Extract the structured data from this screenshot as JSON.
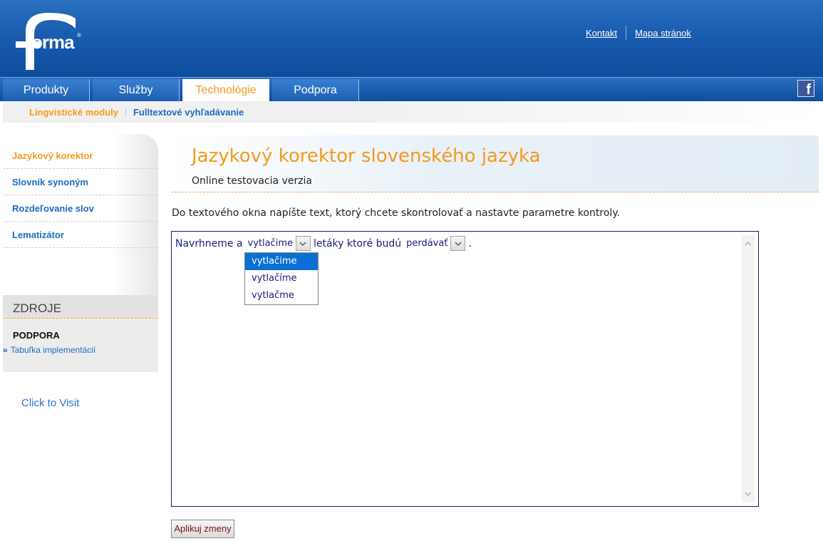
{
  "header": {
    "logo_text": "orma",
    "logo_reg": "®",
    "links": [
      "Kontakt",
      "Mapa stránok"
    ]
  },
  "nav": {
    "tabs": [
      "Produkty",
      "Služby",
      "Technológie",
      "Podpora"
    ],
    "active_tab": "Technológie",
    "facebook_icon": "facebook-icon"
  },
  "subnav": {
    "items": [
      "Lingvistické moduly",
      "Fulltextové vyhľadávanie"
    ]
  },
  "sidebar": {
    "items": [
      "Jazykový korektor",
      "Slovník synoným",
      "Rozdeľovanie slov",
      "Lematizátor"
    ],
    "resources_heading": "ZDROJE",
    "support_heading": "PODPORA",
    "support_link": "Tabuľka implementácií",
    "support_link_chevron": "»",
    "click_visit": "Click to Visit"
  },
  "main": {
    "title": "Jazykový korektor slovenského jazyka",
    "subtitle": "Online testovacia verzia",
    "instructions": "Do textového okna napíšte text, ktorý chcete skontrolovať a nastavte parametre kontroly.",
    "editor": {
      "word1": "Navrhneme a",
      "select1": "vytlačime",
      "word2": "letáky ktoré budú",
      "select2": "perdávať",
      "word3": "."
    },
    "dropdown_options": [
      "vytlačime",
      "vytlačíme",
      "vytlačme"
    ],
    "apply_button": "Aplikuj zmeny"
  },
  "colors": {
    "brand_blue": "#1a5cae",
    "accent_orange": "#f39a1e",
    "link_blue": "#1a6cc2",
    "dropdown_selected": "#0a6fd4"
  }
}
